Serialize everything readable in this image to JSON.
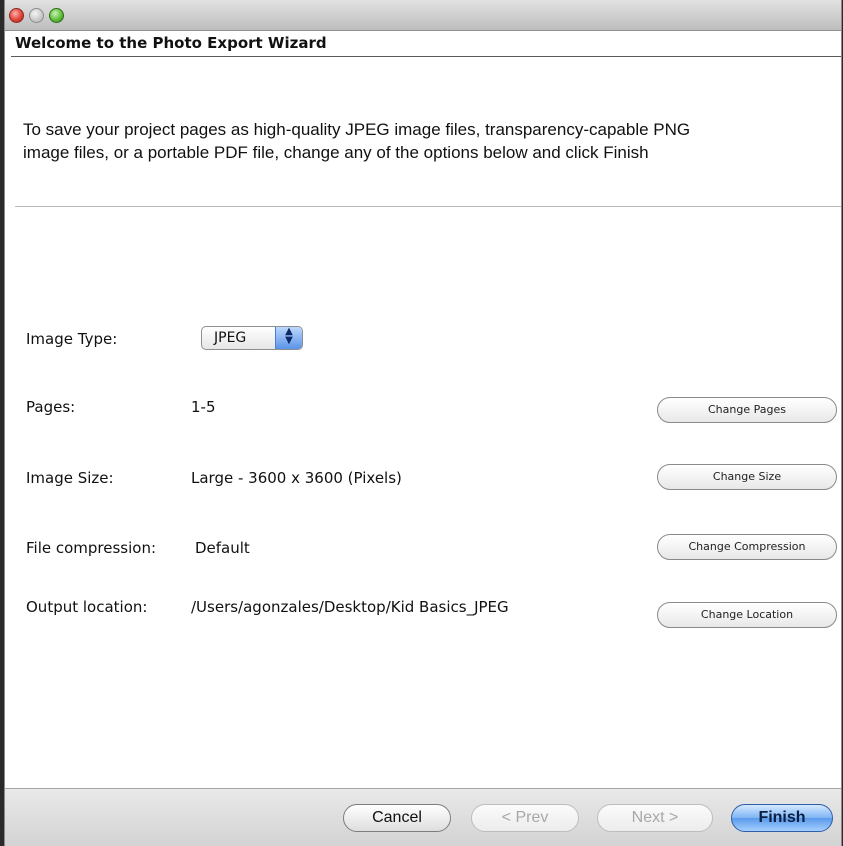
{
  "wizard": {
    "title": "Welcome to the Photo Export Wizard",
    "intro_line1": "To save your project pages as high-quality JPEG image files, transparency-capable PNG",
    "intro_line2": "image files, or a portable PDF file, change any of the options below and click Finish"
  },
  "image_type": {
    "label": "Image Type:",
    "selected": "JPEG"
  },
  "pages": {
    "label": "Pages:",
    "value": "1-5",
    "button": "Change Pages"
  },
  "image_size": {
    "label": "Image Size:",
    "value": "Large - 3600 x 3600 (Pixels)",
    "button": "Change Size"
  },
  "compression": {
    "label": "File compression:",
    "value": "Default",
    "button": "Change Compression"
  },
  "output": {
    "label": "Output location:",
    "value": "/Users/agonzales/Desktop/Kid Basics_JPEG",
    "button": "Change Location"
  },
  "footer": {
    "cancel": "Cancel",
    "prev": "< Prev",
    "next": "Next >",
    "finish": "Finish"
  },
  "icons": {
    "close": "close-traffic-light-icon",
    "minimize": "minimize-traffic-light-icon",
    "zoom": "zoom-traffic-light-icon",
    "stepper": "up-down-stepper-icon"
  },
  "colors": {
    "close": "#e0443a",
    "zoom": "#5fbf3a",
    "accent": "#5a9aea"
  }
}
